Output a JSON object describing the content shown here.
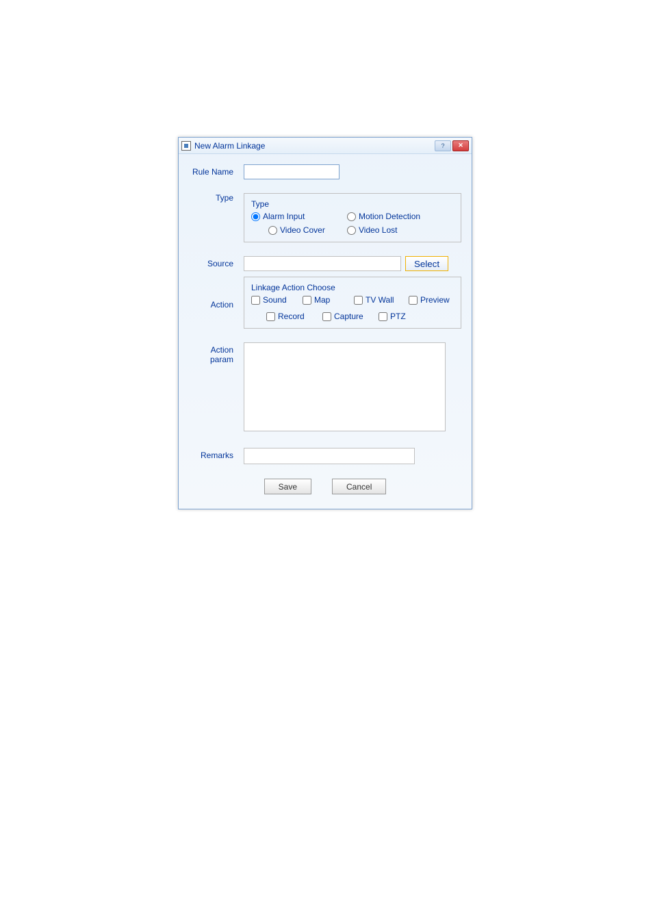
{
  "window": {
    "title": "New Alarm Linkage"
  },
  "labels": {
    "rule_name": "Rule Name",
    "type": "Type",
    "source": "Source",
    "action": "Action",
    "action_param": "Action param",
    "remarks": "Remarks"
  },
  "type_group": {
    "legend": "Type",
    "options": {
      "alarm_input": "Alarm Input",
      "motion_detection": "Motion Detection",
      "video_cover": "Video Cover",
      "video_lost": "Video Lost"
    }
  },
  "linkage_group": {
    "legend": "Linkage Action Choose",
    "options": {
      "sound": "Sound",
      "map": "Map",
      "tv_wall": "TV Wall",
      "preview": "Preview",
      "record": "Record",
      "capture": "Capture",
      "ptz": "PTZ"
    }
  },
  "buttons": {
    "select": "Select",
    "save": "Save",
    "cancel": "Cancel"
  },
  "values": {
    "rule_name": "",
    "source": "",
    "remarks": ""
  }
}
